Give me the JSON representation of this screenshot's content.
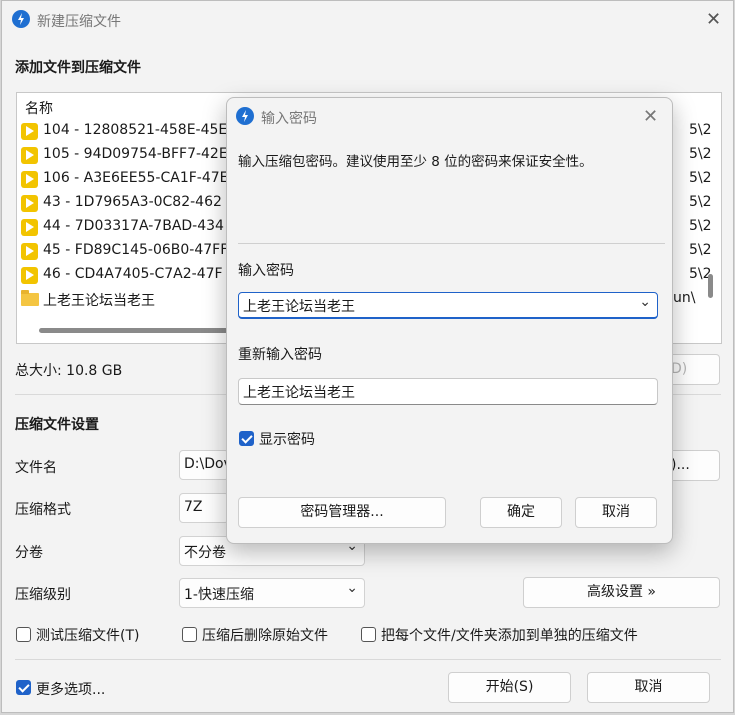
{
  "main_window": {
    "title": "新建压缩文件",
    "add_files_heading": "添加文件到压缩文件",
    "file_list": {
      "column_name": "名称",
      "rows": [
        {
          "name": "104 - 12808521-458E-45E",
          "type": "video",
          "right": "5\\2"
        },
        {
          "name": "105 - 94D09754-BFF7-42E",
          "type": "video",
          "right": "5\\2"
        },
        {
          "name": "106 - A3E6EE55-CA1F-47E",
          "type": "video",
          "right": "5\\2"
        },
        {
          "name": "43 - 1D7965A3-0C82-462",
          "type": "video",
          "right": "5\\2"
        },
        {
          "name": "44 - 7D03317A-7BAD-434",
          "type": "video",
          "right": "5\\2"
        },
        {
          "name": "45 - FD89C145-06B0-47FF",
          "type": "video",
          "right": "5\\2"
        },
        {
          "name": "46 - CD4A7405-C7A2-47F",
          "type": "video",
          "right": "5\\2"
        },
        {
          "name": "上老王论坛当老王",
          "type": "folder",
          "right": "un\\"
        }
      ]
    },
    "total_size": "总大小: 10.8 GB",
    "hidden_button_fragment": "D)",
    "settings_heading": "压缩文件设置",
    "file_name_label": "文件名",
    "file_name_value": "D:\\Dov",
    "browse_button_fragment": ")...",
    "format_label": "压缩格式",
    "format_value": "7Z",
    "volume_label": "分卷",
    "volume_value": "不分卷",
    "level_label": "压缩级别",
    "level_value": "1-快速压缩",
    "advanced_button": "高级设置 »",
    "test_checkbox": "测试压缩文件(T)",
    "delete_checkbox": "压缩后删除原始文件",
    "separate_checkbox": "把每个文件/文件夹添加到单独的压缩文件",
    "more_options_checkbox": "更多选项...",
    "start_button": "开始(S)",
    "cancel_button": "取消"
  },
  "password_dialog": {
    "title": "输入密码",
    "description": "输入压缩包密码。建议使用至少 8 位的密码来保证安全性。",
    "password_label": "输入密码",
    "password_value": "上老王论坛当老王",
    "confirm_label": "重新输入密码",
    "confirm_value": "上老王论坛当老王",
    "show_password": "显示密码",
    "manager_button": "密码管理器...",
    "ok_button": "确定",
    "cancel_button": "取消"
  },
  "colors": {
    "accent": "#1f62c9",
    "video_icon": "#f2c400",
    "folder_icon": "#f4c542"
  }
}
